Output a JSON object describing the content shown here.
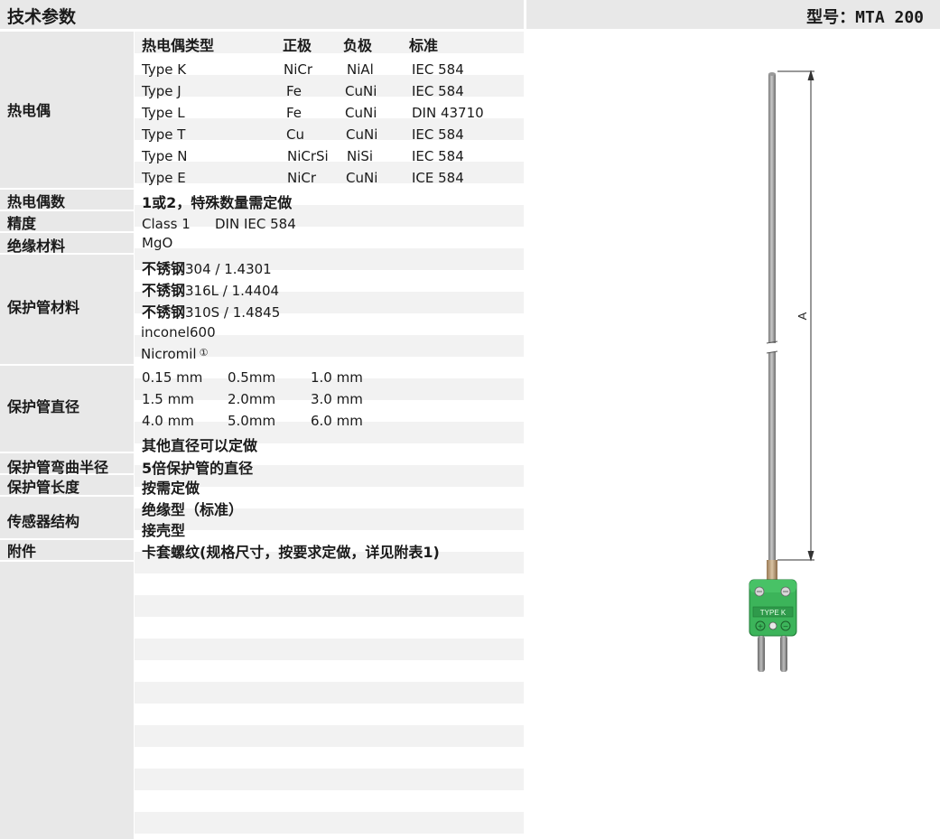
{
  "header": {
    "title": "技术参数",
    "model_label": "型号：",
    "model_value": "MTA 200"
  },
  "labels": {
    "thermocouple": "热电偶",
    "tc_count": "热电偶数",
    "accuracy": "精度",
    "insulation": "绝缘材料",
    "sheath_material": "保护管材料",
    "sheath_diameter": "保护管直径",
    "bend_radius": "保护管弯曲半径",
    "sheath_length": "保护管长度",
    "sensor_construction": "传感器结构",
    "accessories": "附件"
  },
  "thermocouple_table": {
    "headers": [
      "热电偶类型",
      "正极",
      "负极",
      "标准"
    ],
    "rows": [
      [
        "Type K",
        "NiCr",
        "NiAl",
        "IEC 584"
      ],
      [
        "Type J",
        "Fe",
        "CuNi",
        "IEC 584"
      ],
      [
        "Type L",
        "Fe",
        "CuNi",
        "DIN 43710"
      ],
      [
        "Type T",
        "Cu",
        "CuNi",
        "IEC 584"
      ],
      [
        "Type N",
        "NiCrSi",
        "NiSi",
        "IEC 584"
      ],
      [
        "Type E",
        "NiCr",
        "CuNi",
        "ICE 584"
      ]
    ]
  },
  "tc_count": "1或2，特殊数量需定做",
  "accuracy": {
    "class": "Class 1",
    "standard": "DIN IEC 584"
  },
  "insulation": "MgO",
  "sheath_materials": {
    "steel_prefix": "不锈钢",
    "steel_grades": [
      "304 / 1.4301",
      "316L / 1.4404",
      "310S / 1.4845"
    ],
    "others": [
      "inconel600",
      "Nicromil"
    ],
    "nicromil_note": "①"
  },
  "diameters": {
    "rows": [
      [
        "0.15 mm",
        "0.5mm",
        "1.0 mm"
      ],
      [
        "1.5 mm",
        "2.0mm",
        "3.0 mm"
      ],
      [
        "4.0 mm",
        "5.0mm",
        "6.0 mm"
      ]
    ],
    "custom": "其他直径可以定做"
  },
  "bend_radius": "5倍保护管的直径",
  "sheath_length": "按需定做",
  "sensor_construction": [
    "绝缘型（标准）",
    "接壳型"
  ],
  "accessories": "卡套螺纹(规格尺寸，按要求定做，详见附表1)",
  "drawing": {
    "dimension_label": "A",
    "connector_marking": "TYPE K",
    "plus_symbol": "+",
    "minus_symbol": "−",
    "connector_color": "#3cb45a"
  }
}
